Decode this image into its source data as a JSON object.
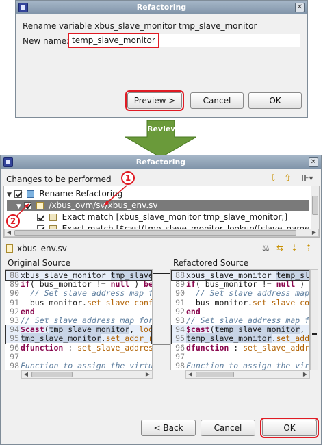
{
  "rename_dialog": {
    "title": "Refactoring",
    "description": "Rename variable xbus_slave_monitor tmp_slave_monitor",
    "new_name_label": "New name:",
    "new_name_value": "temp_slave_monitor",
    "preview_label": "Preview >",
    "cancel_label": "Cancel",
    "ok_label": "OK"
  },
  "review_arrow_label": "Review",
  "preview_dialog": {
    "title": "Refactoring",
    "changes_header": "Changes to be performed",
    "tree": [
      "Rename Refactoring",
      "/xbus_ovm/sv/xbus_env.sv",
      "Exact match [xbus_slave_monitor tmp_slave_monitor;]",
      "Exact match [$cast(tmp_slave_monitor_lookup([slave_name, \".monitor\"])"
    ],
    "file_label": "xbus_env.sv",
    "original_header": "Original Source",
    "refactored_header": "Refactored Source",
    "callouts": [
      "1",
      "2"
    ],
    "back_label": "< Back",
    "cancel_label": "Cancel",
    "ok_label": "OK"
  },
  "original_code": [
    {
      "n": "88",
      "t": "xbus_slave_monitor tmp_slave_mo"
    },
    {
      "n": "89",
      "t": "if( bus_monitor != null ) begin"
    },
    {
      "n": "90",
      "t": "  // Set slave address map for"
    },
    {
      "n": "91",
      "t": "  bus_monitor.set_slave_configs"
    },
    {
      "n": "92",
      "t": "end"
    },
    {
      "n": "93",
      "t": "// Set slave address map for sl"
    },
    {
      "n": "94",
      "t": "$cast(tmp_slave_monitor, lookup"
    },
    {
      "n": "95",
      "t": "tmp_slave_monitor.set_addr_rang"
    },
    {
      "n": "96",
      "t": "dfunction : set_slave_address_m"
    },
    {
      "n": "97",
      "t": ""
    },
    {
      "n": "98",
      "t": "Function to assign the virtual"
    }
  ],
  "refactored_code": [
    {
      "n": "88",
      "t": "xbus_slave_monitor temp_slav"
    },
    {
      "n": "89",
      "t": "if( bus_monitor != null ) be"
    },
    {
      "n": "90",
      "t": "  // Set slave address map"
    },
    {
      "n": "91",
      "t": "  bus_monitor.set_slave_conf"
    },
    {
      "n": "92",
      "t": "end"
    },
    {
      "n": "93",
      "t": "// Set slave address map fo"
    },
    {
      "n": "94",
      "t": "$cast(temp_slave_monitor, l"
    },
    {
      "n": "95",
      "t": "temp_slave_monitor.set_addr"
    },
    {
      "n": "96",
      "t": "dfunction : set_slave_addre"
    },
    {
      "n": "97",
      "t": ""
    },
    {
      "n": "98",
      "t": "Function to assign the vir"
    }
  ],
  "colors": {
    "highlight_red": "#e01b24",
    "review_arrow_green": "#6a9a3a",
    "selected_row": "#7a7a7a"
  }
}
